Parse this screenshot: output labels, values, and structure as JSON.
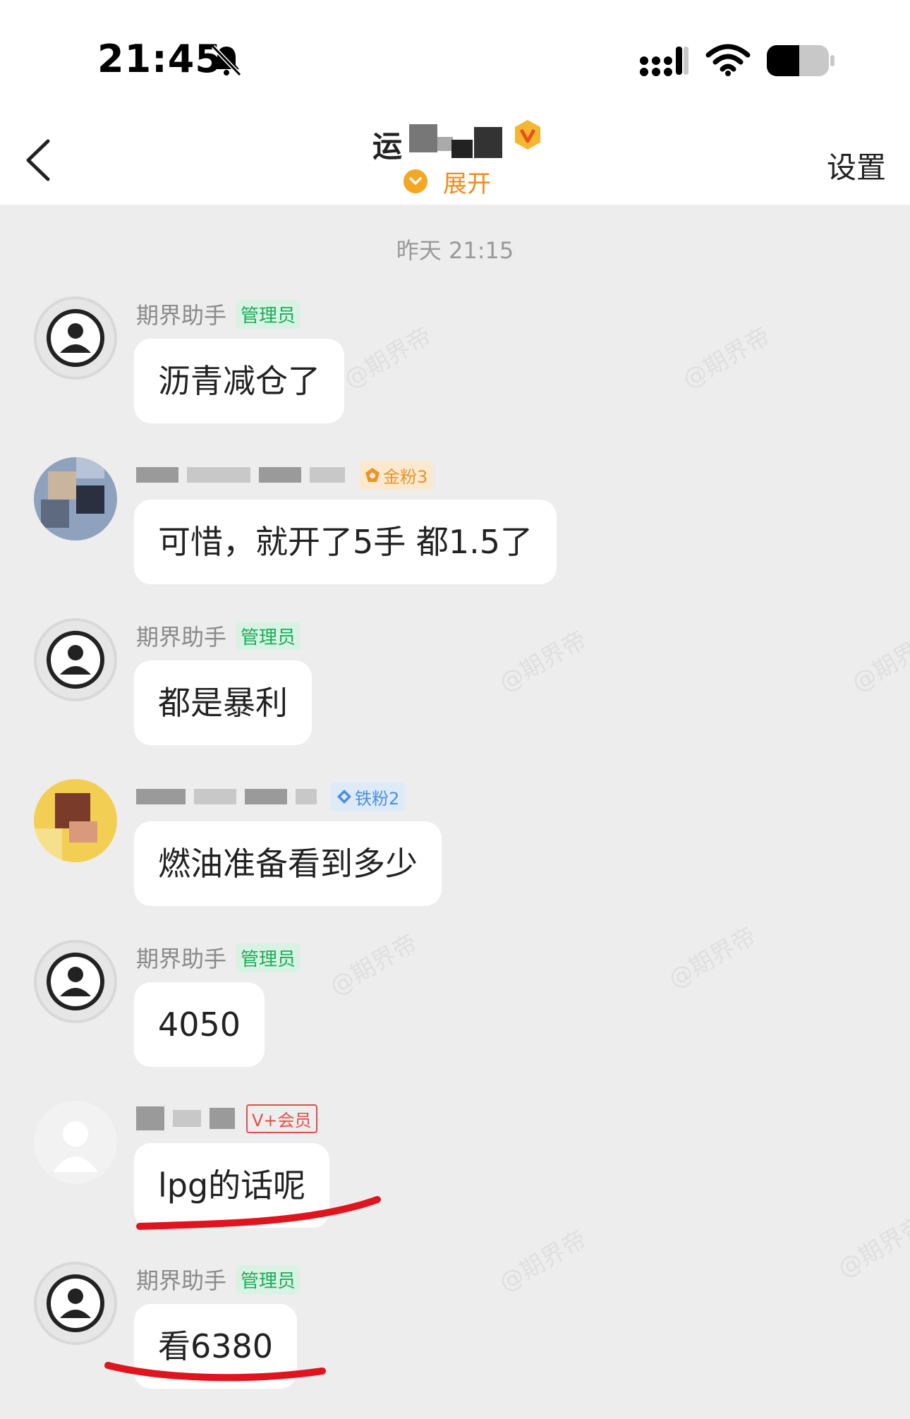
{
  "status_bar": {
    "time": "21:45"
  },
  "nav": {
    "title": "运",
    "expand_label": "展开",
    "settings_label": "设置"
  },
  "chat": {
    "timestamp": "昨天 21:15",
    "watermark": "@期界帝",
    "messages": [
      {
        "sender": "期界助手",
        "badge": "管理员",
        "text": "沥青减仓了"
      },
      {
        "sender": "",
        "badge": "金粉3",
        "text": "可惜，就开了5手 都1.5了"
      },
      {
        "sender": "期界助手",
        "badge": "管理员",
        "text": "都是暴利"
      },
      {
        "sender": "",
        "badge": "铁粉2",
        "text": "燃油准备看到多少"
      },
      {
        "sender": "期界助手",
        "badge": "管理员",
        "text": "4050"
      },
      {
        "sender": "",
        "badge": "V+会员",
        "text": "lpg的话呢"
      },
      {
        "sender": "期界助手",
        "badge": "管理员",
        "text": "看6380"
      }
    ]
  },
  "colors": {
    "background": "#ededed",
    "accent_orange": "#f08c1a",
    "admin_green": "#1aad5a",
    "annotation_red": "#e0141e"
  }
}
